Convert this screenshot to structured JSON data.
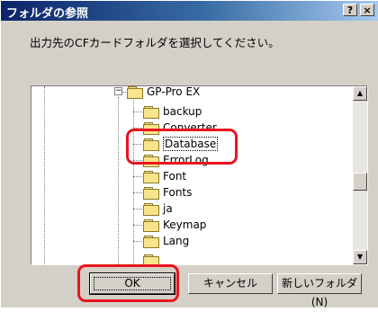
{
  "dialog": {
    "title": "フォルダの参照",
    "help_button": "?",
    "close_button": "×",
    "instruction": "出力先のCFカードフォルダを選択してください。"
  },
  "tree": {
    "expander": "−",
    "items": [
      {
        "label": "GP-Pro EX"
      },
      {
        "label": "backup"
      },
      {
        "label": "Converter"
      },
      {
        "label": "Database"
      },
      {
        "label": "ErrorLog"
      },
      {
        "label": "Font"
      },
      {
        "label": "Fonts"
      },
      {
        "label": "ja"
      },
      {
        "label": "Keymap"
      },
      {
        "label": "Lang"
      }
    ],
    "selected_item": "Database"
  },
  "buttons": {
    "ok": "OK",
    "cancel": "キャンセル",
    "new_folder": "新しいフォルダ(N)"
  },
  "colors": {
    "annotation": "#e8141e",
    "titlebar": "#0a246a"
  }
}
